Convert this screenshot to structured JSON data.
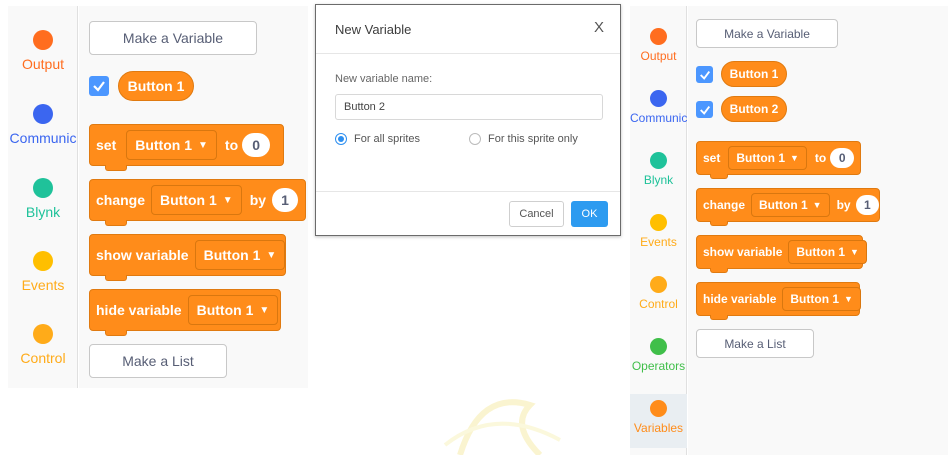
{
  "left": {
    "categories": [
      {
        "label": "Output",
        "color": "#ff6d1f",
        "label_color": "#ff6d1f"
      },
      {
        "label": "Communic",
        "color": "#3b66f0",
        "label_color": "#3b66f0"
      },
      {
        "label": "Blynk",
        "color": "#1fc29a",
        "label_color": "#1fc29a"
      },
      {
        "label": "Events",
        "color": "#ffbf00",
        "label_color": "#ffab19"
      },
      {
        "label": "Control",
        "color": "#ffab19",
        "label_color": "#ffab19"
      }
    ],
    "make_variable": "Make a Variable",
    "variable_pill": "Button 1",
    "set_block": {
      "kw": "set",
      "var": "Button 1",
      "to": "to",
      "value": "0"
    },
    "change_block": {
      "kw": "change",
      "var": "Button 1",
      "by": "by",
      "value": "1"
    },
    "show_block": {
      "kw": "show variable",
      "var": "Button 1"
    },
    "hide_block": {
      "kw": "hide variable",
      "var": "Button 1"
    },
    "make_list": "Make a List"
  },
  "dialog": {
    "title": "New Variable",
    "close": "X",
    "name_label": "New variable name:",
    "name_value": "Button 2",
    "option_all": "For all sprites",
    "option_this": "For this sprite only",
    "selected": "option_all",
    "cancel": "Cancel",
    "ok": "OK",
    "accent": "#2d9bf0"
  },
  "right": {
    "categories": [
      {
        "label": "Output",
        "color": "#ff6d1f",
        "label_color": "#ff6d1f"
      },
      {
        "label": "Communic",
        "color": "#3b66f0",
        "label_color": "#3b66f0"
      },
      {
        "label": "Blynk",
        "color": "#1fc29a",
        "label_color": "#1fc29a"
      },
      {
        "label": "Events",
        "color": "#ffbf00",
        "label_color": "#ffab19"
      },
      {
        "label": "Control",
        "color": "#ffab19",
        "label_color": "#ffab19"
      },
      {
        "label": "Operators",
        "color": "#40bf4a",
        "label_color": "#40bf4a"
      },
      {
        "label": "Variables",
        "color": "#ff8c1a",
        "label_color": "#ff8c1a"
      }
    ],
    "make_variable": "Make a Variable",
    "variable_pills": [
      "Button 1",
      "Button 2"
    ],
    "set_block": {
      "kw": "set",
      "var": "Button 1",
      "to": "to",
      "value": "0"
    },
    "change_block": {
      "kw": "change",
      "var": "Button 1",
      "by": "by",
      "value": "1"
    },
    "show_block": {
      "kw": "show variable",
      "var": "Button 1"
    },
    "hide_block": {
      "kw": "hide variable",
      "var": "Button 1"
    },
    "make_list": "Make a List"
  },
  "icons": {
    "checkbox": "checkmark-icon",
    "dropdown": "caret-down-icon",
    "close": "close-icon"
  },
  "colors": {
    "block": "#ff8c1a",
    "checkbox": "#4c97ff"
  }
}
